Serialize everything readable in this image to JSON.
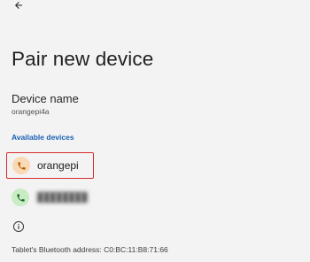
{
  "header": {
    "back_icon": "arrow-back-icon"
  },
  "page": {
    "title": "Pair new device"
  },
  "device_name": {
    "label": "Device name",
    "value": "orangepi4a"
  },
  "available_devices": {
    "header": "Available devices",
    "items": [
      {
        "name": "orangepi",
        "icon": "phone-icon",
        "icon_bg": "#f9d9b6",
        "icon_color": "#b25f00",
        "highlighted": true
      },
      {
        "name": "████████",
        "icon": "phone-icon",
        "icon_bg": "#c9ecc4",
        "icon_color": "#1e6b2e",
        "highlighted": false
      }
    ]
  },
  "footer": {
    "info_icon": "info-icon",
    "bt_address": "Tablet's Bluetooth address: C0:BC:11:B8:71:66"
  },
  "colors": {
    "accent": "#1a5fb4",
    "highlight_border": "#d92b2b",
    "background": "#f3f3f3"
  }
}
